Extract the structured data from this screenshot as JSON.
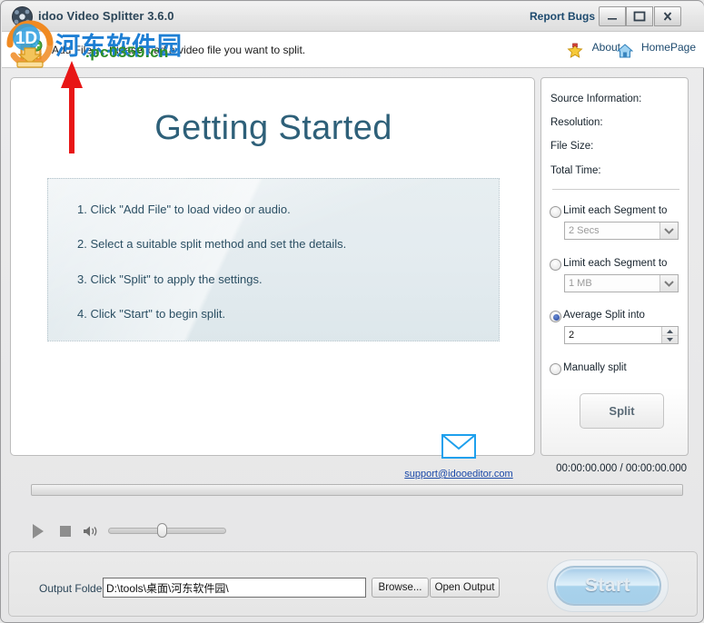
{
  "window": {
    "title": "idoo Video Splitter 3.6.0",
    "report_bugs": "Report Bugs",
    "minimize_icon": "minimize-icon",
    "maximize_icon": "maximize-icon",
    "close_icon": "close-icon",
    "app_icon": "film-reel-icon"
  },
  "toolbar": {
    "add_file_label": "Add File .",
    "add_file_hint": "Please load a video file you want to split.",
    "add_file_icon": "add-file-icon",
    "about_label": "About",
    "about_icon": "star-icon",
    "homepage_label": "HomePage",
    "homepage_icon": "home-icon"
  },
  "main": {
    "heading": "Getting Started",
    "steps": [
      "1. Click \"Add File\" to load video or audio.",
      "2. Select a suitable split method and set the details.",
      "3. Click \"Split\" to apply the settings.",
      "4. Click \"Start\" to begin split."
    ],
    "support_email": "support@idooeditor.com",
    "mail_icon": "envelope-icon"
  },
  "side_panel": {
    "source_information_label": "Source Information:",
    "resolution_label": "Resolution:",
    "file_size_label": "File Size:",
    "total_time_label": "Total Time:",
    "options": [
      {
        "label": "Limit each Segment to",
        "selected": false,
        "value": "2 Secs",
        "control": "combo",
        "enabled": false
      },
      {
        "label": "Limit each Segment to",
        "selected": false,
        "value": "1 MB",
        "control": "combo",
        "enabled": false
      },
      {
        "label": "Average Split into",
        "selected": true,
        "value": "2",
        "control": "spinner",
        "enabled": true
      },
      {
        "label": "Manually split",
        "selected": false,
        "value": "",
        "control": "none",
        "enabled": false
      }
    ],
    "split_button_label": "Split"
  },
  "player": {
    "time_display": "00:00:00.000 / 00:00:00.000",
    "play_icon": "play-icon",
    "stop_icon": "stop-icon",
    "volume_icon": "speaker-icon",
    "seek_position_percent": 0,
    "volume_percent": 42
  },
  "footer": {
    "output_folder_label": "Output Folder:",
    "output_folder_value": "D:\\tools\\桌面\\河东软件园\\",
    "browse_label": "Browse...",
    "open_output_label": "Open Output",
    "start_label": "Start"
  },
  "watermark": {
    "logo_text": "1D",
    "site_name_cn": "河东软件园",
    "site_url": ".pc0359.cn",
    "logo_icon": "download-watermark-icon",
    "arrow_icon": "red-arrow-up-icon"
  },
  "colors": {
    "accent_blue": "#2e6079",
    "link_blue": "#1b49a8",
    "watermark_blue": "#1e7fd4",
    "watermark_green": "#2f8f2b",
    "annotation_red": "#e81616",
    "radio_selected": "#2f4fa5"
  }
}
